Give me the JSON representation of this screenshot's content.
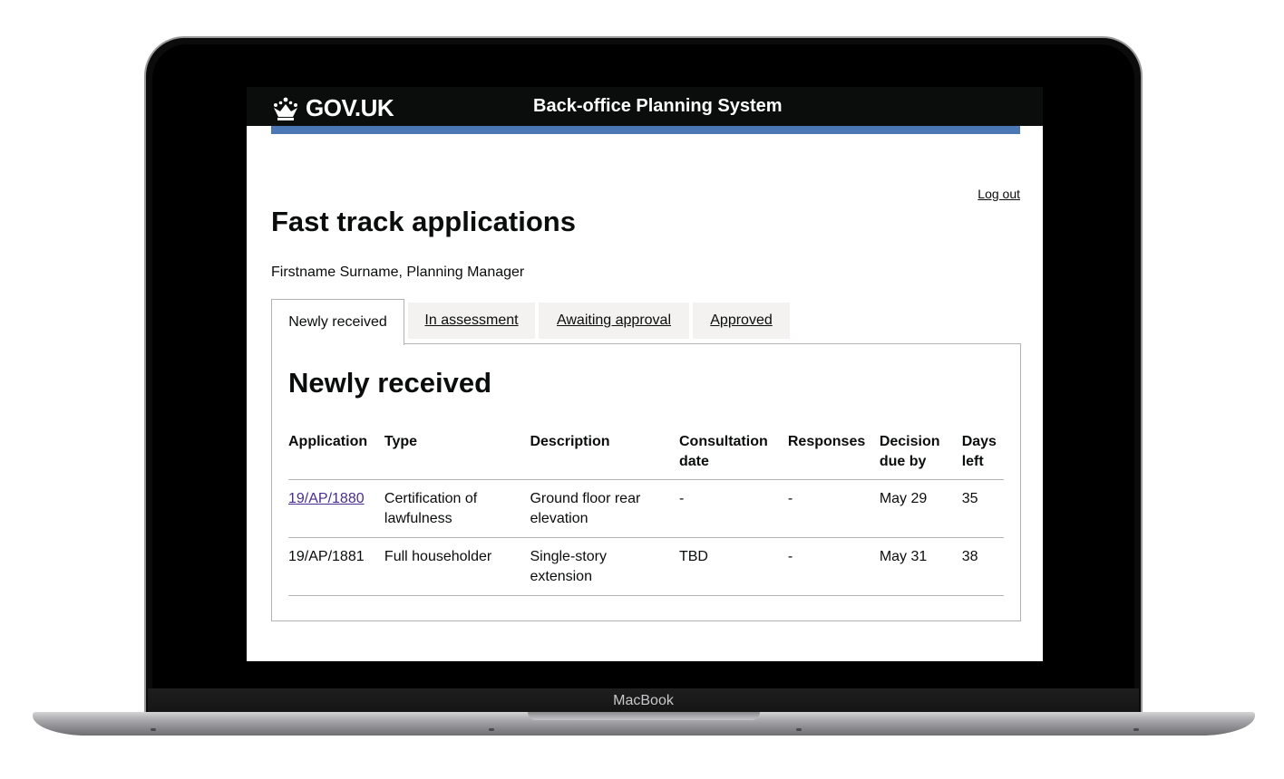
{
  "device": {
    "model_label": "MacBook"
  },
  "header": {
    "logo_text": "GOV.UK",
    "service_name": "Back-office Planning System"
  },
  "colors": {
    "header_bg": "#0b0c0c",
    "blue_bar": "#4c77b5",
    "tab_bg": "#f3f2f1",
    "link_visited": "#4c2c92",
    "border": "#b1b4b6"
  },
  "page": {
    "logout": "Log out",
    "title": "Fast track applications",
    "user": "Firstname Surname, Planning Manager"
  },
  "tabs": [
    {
      "label": "Newly received",
      "selected": true
    },
    {
      "label": "In assessment",
      "selected": false
    },
    {
      "label": "Awaiting approval",
      "selected": false
    },
    {
      "label": "Approved",
      "selected": false
    }
  ],
  "panel": {
    "heading": "Newly received",
    "columns": [
      "Application",
      "Type",
      "Description",
      "Consultation date",
      "Responses",
      "Decision due by",
      "Days left"
    ],
    "rows": [
      {
        "application": "19/AP/1880",
        "type": "Certification of lawfulness",
        "description": "Ground floor rear elevation",
        "consultation": "-",
        "responses": "-",
        "decision": "May 29",
        "days": "35"
      },
      {
        "application": "19/AP/1881",
        "type": "Full householder",
        "description": "Single-story extension",
        "consultation": "TBD",
        "responses": "-",
        "decision": "May 31",
        "days": "38"
      }
    ]
  }
}
